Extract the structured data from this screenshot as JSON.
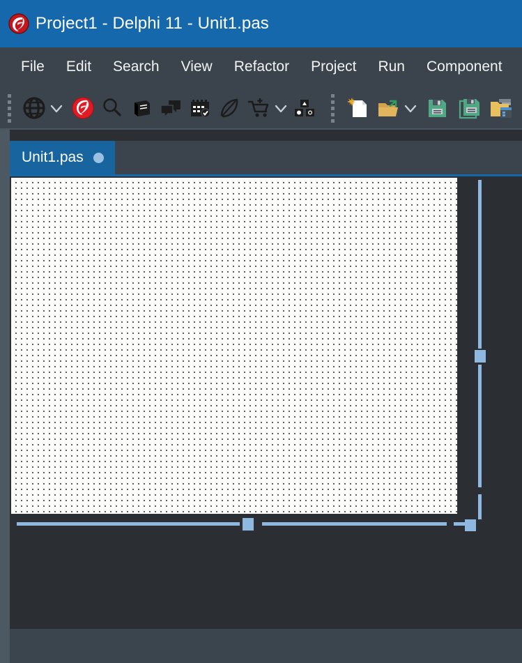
{
  "window": {
    "title": "Project1 - Delphi 11 - Unit1.pas",
    "app_icon": "delphi-helmet-icon",
    "titlebar_color": "#1668ac"
  },
  "menubar": {
    "items": [
      {
        "label": "File"
      },
      {
        "label": "Edit"
      },
      {
        "label": "Search"
      },
      {
        "label": "View"
      },
      {
        "label": "Refactor"
      },
      {
        "label": "Project"
      },
      {
        "label": "Run"
      },
      {
        "label": "Component"
      }
    ]
  },
  "toolbar": {
    "groups": [
      {
        "items": [
          {
            "icon": "grip-handle-icon",
            "type": "grip"
          },
          {
            "icon": "globe-icon",
            "type": "button"
          },
          {
            "icon": "chevron-down-icon",
            "type": "dropdown"
          },
          {
            "icon": "delphi-helmet-icon",
            "type": "button"
          },
          {
            "icon": "magnifier-icon",
            "type": "button"
          },
          {
            "icon": "book-icon",
            "type": "button"
          },
          {
            "icon": "chat-bubbles-icon",
            "type": "button"
          },
          {
            "icon": "calendar-check-icon",
            "type": "button"
          },
          {
            "icon": "feather-quill-icon",
            "type": "button"
          },
          {
            "icon": "cart-plus-icon",
            "type": "button"
          },
          {
            "icon": "chevron-down-icon",
            "type": "dropdown"
          },
          {
            "icon": "packages-blocks-icon",
            "type": "button"
          }
        ]
      },
      {
        "items": [
          {
            "icon": "grip-handle-icon",
            "type": "grip"
          },
          {
            "icon": "new-file-icon",
            "type": "button"
          },
          {
            "icon": "open-folder-icon",
            "type": "button"
          },
          {
            "icon": "chevron-down-icon",
            "type": "dropdown"
          },
          {
            "icon": "save-floppy-icon",
            "type": "button"
          },
          {
            "icon": "save-all-floppy-icon",
            "type": "button"
          },
          {
            "icon": "save-project-icon",
            "type": "button"
          }
        ]
      }
    ]
  },
  "editor": {
    "tabs": [
      {
        "label": "Unit1.pas",
        "active": true,
        "indicator": "modified-dot"
      }
    ]
  },
  "designer": {
    "surface": "form-design-canvas",
    "grid": "dot-grid",
    "scroll": {
      "vertical_thumb": "vertical-scroll-thumb",
      "horizontal_thumb": "horizontal-scroll-thumb",
      "corner": "scroll-corner"
    }
  },
  "colors": {
    "title_blue": "#1668ac",
    "chrome_dark": "#3b444c",
    "workspace_dark": "#2b2e33",
    "tab_active_blue": "#17649f",
    "scroll_blue": "#8fb8e0",
    "rail_grey": "#4c5862",
    "panel_grey": "#3b454e"
  }
}
